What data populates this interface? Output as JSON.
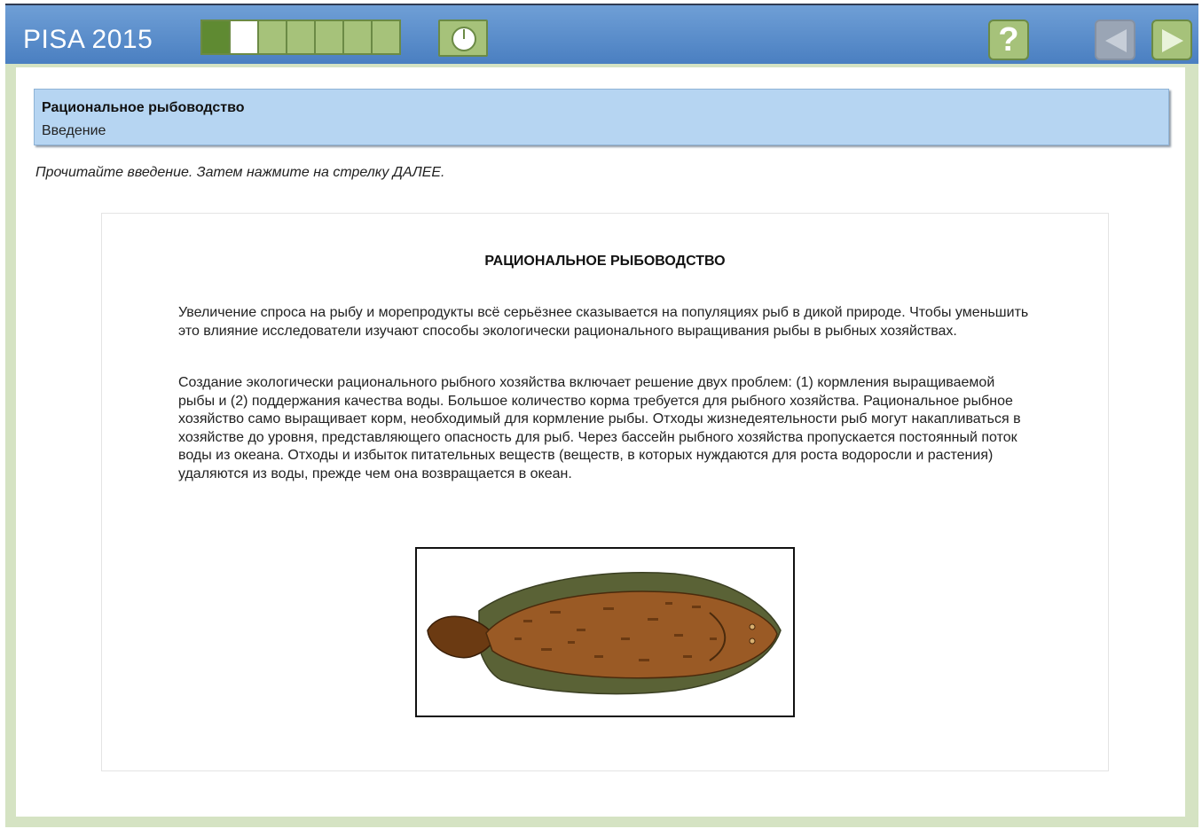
{
  "app": {
    "brand": "PISA 2015"
  },
  "toolbar": {
    "progress": {
      "total_segments": 6,
      "completed_segments": 1,
      "current_segment": 2
    },
    "timer_icon": "clock-icon",
    "help_label": "?",
    "back_icon": "arrow-left-icon",
    "next_icon": "arrow-right-icon"
  },
  "unit": {
    "title": "Рациональное рыбоводство",
    "subtitle": "Введение"
  },
  "instruction": "Прочитайте введение. Затем нажмите на стрелку ДАЛЕЕ.",
  "stimulus": {
    "title": "РАЦИОНАЛЬНОЕ РЫБОВОДСТВО",
    "paragraphs": [
      "Увеличение спроса на рыбу и морепродукты всё серьёзнее сказывается на популяциях рыб в дикой природе. Чтобы уменьшить это влияние исследователи изучают способы экологически рационального выращивания рыбы в рыбных хозяйствах.",
      "Создание экологически рационального рыбного хозяйства включает решение двух проблем: (1) кормления выращиваемой рыбы и (2) поддержания качества воды. Большое количество корма требуется для рыбного хозяйства. Рациональное рыбное хозяйство само выращивает корм, необходимый для кормление рыбы. Отходы жизнедеятельности рыб могут накапливаться в хозяйстве до уровня, представляющего опасность для рыб. Через бассейн рыбного хозяйства пропускается постоянный поток воды из океана. Отходы и избыток питательных веществ (веществ, в которых нуждаются для роста водоросли и растения) удаляются из воды, прежде чем она возвращается в океан."
    ],
    "image_icon": "flatfish-illustration"
  },
  "colors": {
    "topbar": "#4a7fc1",
    "accent_green": "#a6c27a",
    "header_blue": "#b6d5f2",
    "frame": "#d5e3c3"
  }
}
